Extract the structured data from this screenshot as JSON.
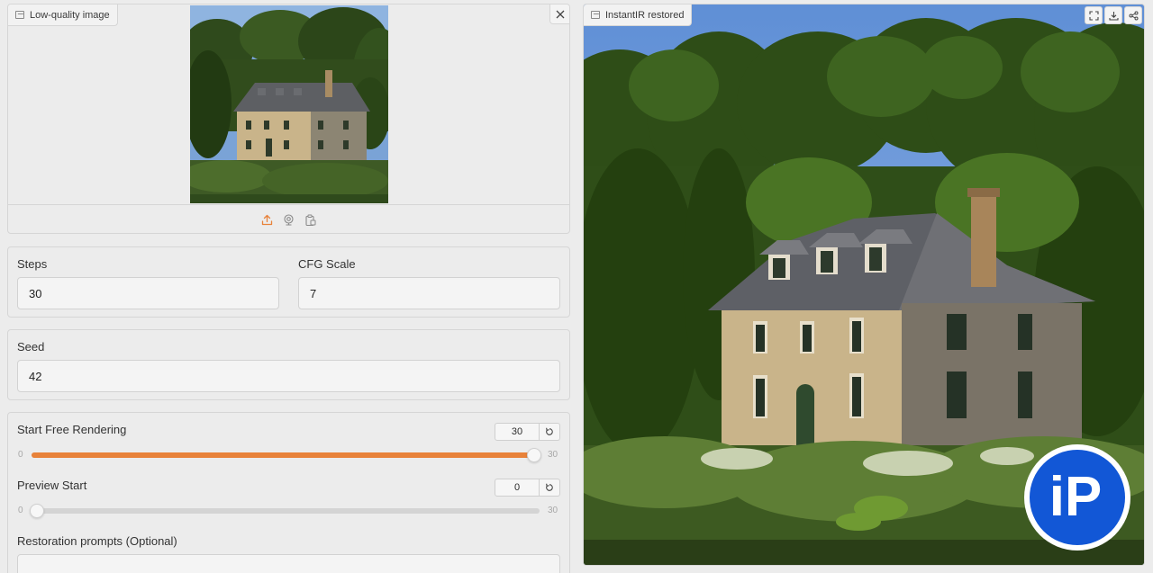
{
  "input_image": {
    "label": "Low-quality image",
    "toolbar_icons": [
      "upload-icon",
      "webcam-icon",
      "clipboard-icon"
    ],
    "close_icon": "close-icon"
  },
  "params": {
    "steps": {
      "label": "Steps",
      "value": "30"
    },
    "cfg_scale": {
      "label": "CFG Scale",
      "value": "7"
    },
    "seed": {
      "label": "Seed",
      "value": "42"
    }
  },
  "sliders": {
    "start_free_rendering": {
      "label": "Start Free Rendering",
      "value": "30",
      "min": "0",
      "max": "30",
      "fraction": 1.0
    },
    "preview_start": {
      "label": "Preview Start",
      "value": "0",
      "min": "0",
      "max": "30",
      "fraction": 0.0
    }
  },
  "prompts": {
    "label": "Restoration prompts (Optional)",
    "value": ""
  },
  "output_image": {
    "label": "InstantIR restored",
    "toolbar_icons": [
      "fullscreen-icon",
      "download-icon",
      "share-icon"
    ]
  },
  "watermark": {
    "text": "iP"
  },
  "colors": {
    "accent": "#e8823a",
    "panel": "#ececec",
    "border": "#d6d6d6",
    "watermark_blue": "#1257d6"
  }
}
